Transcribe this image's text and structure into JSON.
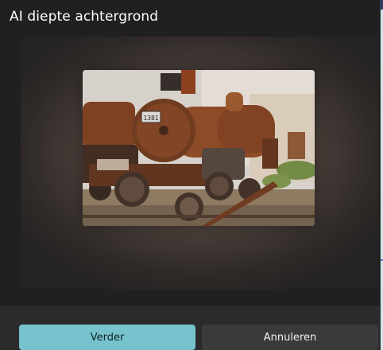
{
  "dialog": {
    "title": "AI diepte achtergrond"
  },
  "preview": {
    "image_description_icon": "photo-image",
    "locomotive_number": "1381"
  },
  "footer": {
    "primary_label": "Verder",
    "secondary_label": "Annuleren"
  },
  "colors": {
    "primary": "#76c3cd",
    "dialog_bg": "#202020",
    "footer_bg": "#2b2b2b",
    "secondary_bg": "#3a3a3a"
  }
}
